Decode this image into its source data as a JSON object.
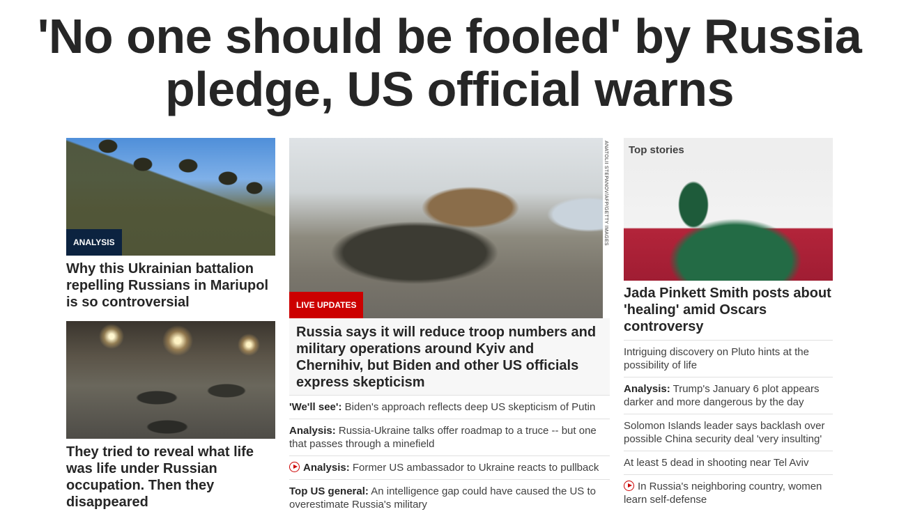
{
  "headline": "'No one should be fooled' by Russia pledge, US official warns",
  "left": {
    "story1": {
      "tag": "ANALYSIS",
      "title": "Why this Ukrainian battalion repelling Russians in Mariupol is so controversial"
    },
    "story2": {
      "title": "They tried to reveal what life was life under Russian occupation. Then they disappeared"
    }
  },
  "middle": {
    "photo_credit": "ANATOLII STEPANOV/AFP/GETTY IMAGES",
    "tag": "LIVE UPDATES",
    "title": "Russia says it will reduce troop numbers and military operations around Kyiv and Chernihiv, but Biden and other US officials express skepticism",
    "items": [
      {
        "label": "'We'll see':",
        "text": " Biden's approach reflects deep US skepticism of Putin",
        "video": false
      },
      {
        "label": "Analysis:",
        "text": " Russia-Ukraine talks offer roadmap to a truce -- but one that passes through a minefield",
        "video": false
      },
      {
        "label": "Analysis:",
        "text": " Former US ambassador to Ukraine reacts to pullback",
        "video": true
      },
      {
        "label": "Top US general:",
        "text": " An intelligence gap could have caused the US to overestimate Russia's military",
        "video": false
      }
    ]
  },
  "right": {
    "section_title": "Top stories",
    "lead_title": "Jada Pinkett Smith posts about 'healing' amid Oscars controversy",
    "items": [
      {
        "label": "",
        "text": "Intriguing discovery on Pluto hints at the possibility of life",
        "video": false
      },
      {
        "label": "Analysis:",
        "text": " Trump's January 6 plot appears darker and more dangerous by the day",
        "video": false
      },
      {
        "label": "",
        "text": "Solomon Islands leader says backlash over possible China security deal 'very insulting'",
        "video": false
      },
      {
        "label": "",
        "text": "At least 5 dead in shooting near Tel Aviv",
        "video": false
      },
      {
        "label": "",
        "text": "In Russia's neighboring country, women learn self-defense",
        "video": true
      }
    ]
  },
  "colors": {
    "text": "#262626",
    "analysis_tag": "#0c2340",
    "live_tag": "#cc0000",
    "video_icon": "#cc0000"
  }
}
